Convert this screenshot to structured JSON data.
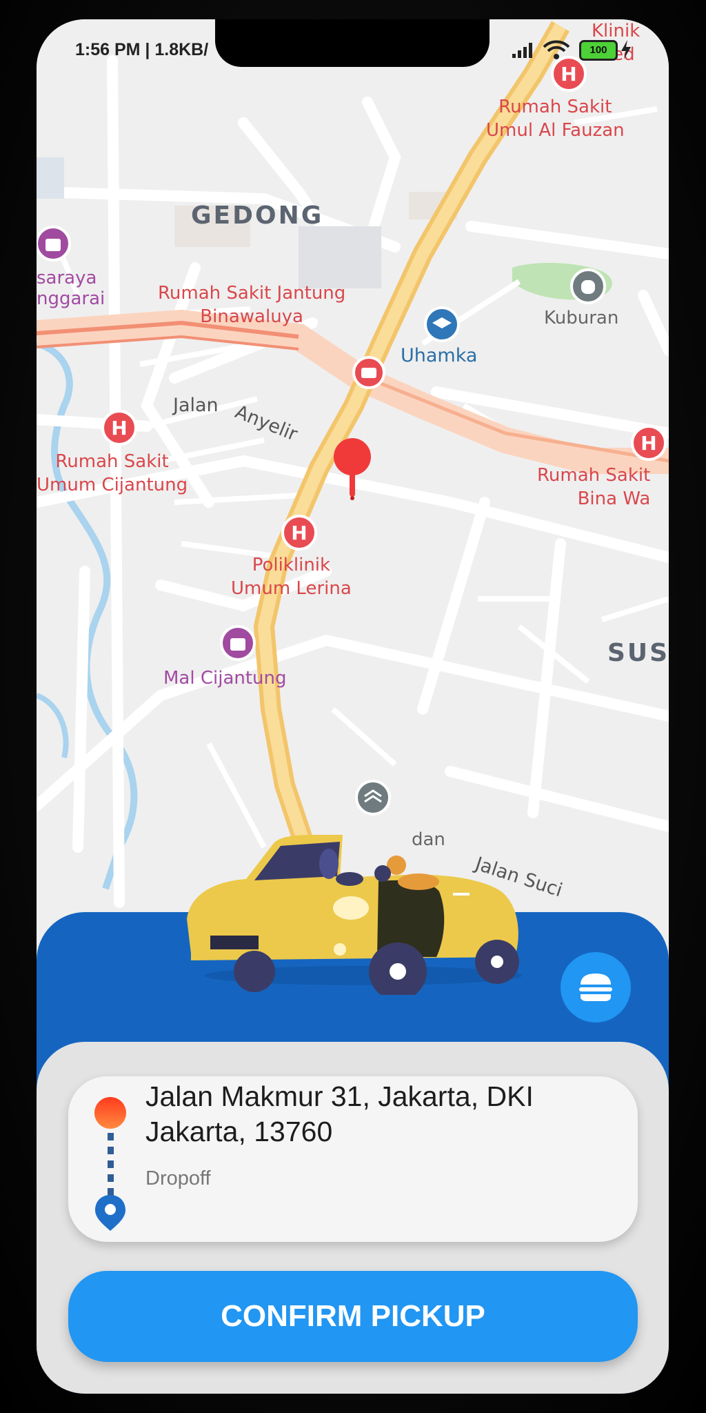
{
  "status_bar": {
    "time_speed": "1:56 PM | 1.8KB/",
    "battery": "100"
  },
  "map": {
    "labels": {
      "gedong": "GEDONG",
      "sus": "SUS",
      "rs_jantung_1": "Rumah Sakit Jantung",
      "rs_jantung_2": "Binawaluya",
      "rs_umul_1": "Rumah Sakit",
      "rs_umul_2": "Umul Al Fauzan",
      "klinik_1": "Klinik",
      "klinik_2": "Med",
      "saraya_1": "saraya",
      "saraya_2": "nggarai",
      "kuburan": "Kuburan",
      "uhamka": "Uhamka",
      "jalan": "Jalan",
      "anyelir": "Anyelir",
      "rs_cijantung_1": "Rumah Sakit",
      "rs_cijantung_2": "Umum Cijantung",
      "rs_bina_1": "Rumah Sakit",
      "rs_bina_2": "Bina Wa",
      "poliklinik_1": "Poliklinik",
      "poliklinik_2": "Umum Lerina",
      "mal": "Mal Cijantung",
      "dan": "dan",
      "jalan_suci": "Jalan Suci"
    }
  },
  "trip": {
    "address": "Jalan Makmur 31, Jakarta, DKI Jakarta, 13760",
    "dropoff_label": "Dropoff"
  },
  "actions": {
    "confirm_label": "CONFIRM PICKUP"
  },
  "colors": {
    "primary_dark": "#1565c0",
    "primary": "#2196f3",
    "pin_red": "#f03a3a",
    "route_yellow": "#f6cf71"
  },
  "icons": {
    "menu": "burger-icon",
    "pickup": "origin-dot-icon",
    "dropoff": "location-pin-icon",
    "map_pin": "map-pin-icon",
    "vehicle": "car-illustration"
  }
}
